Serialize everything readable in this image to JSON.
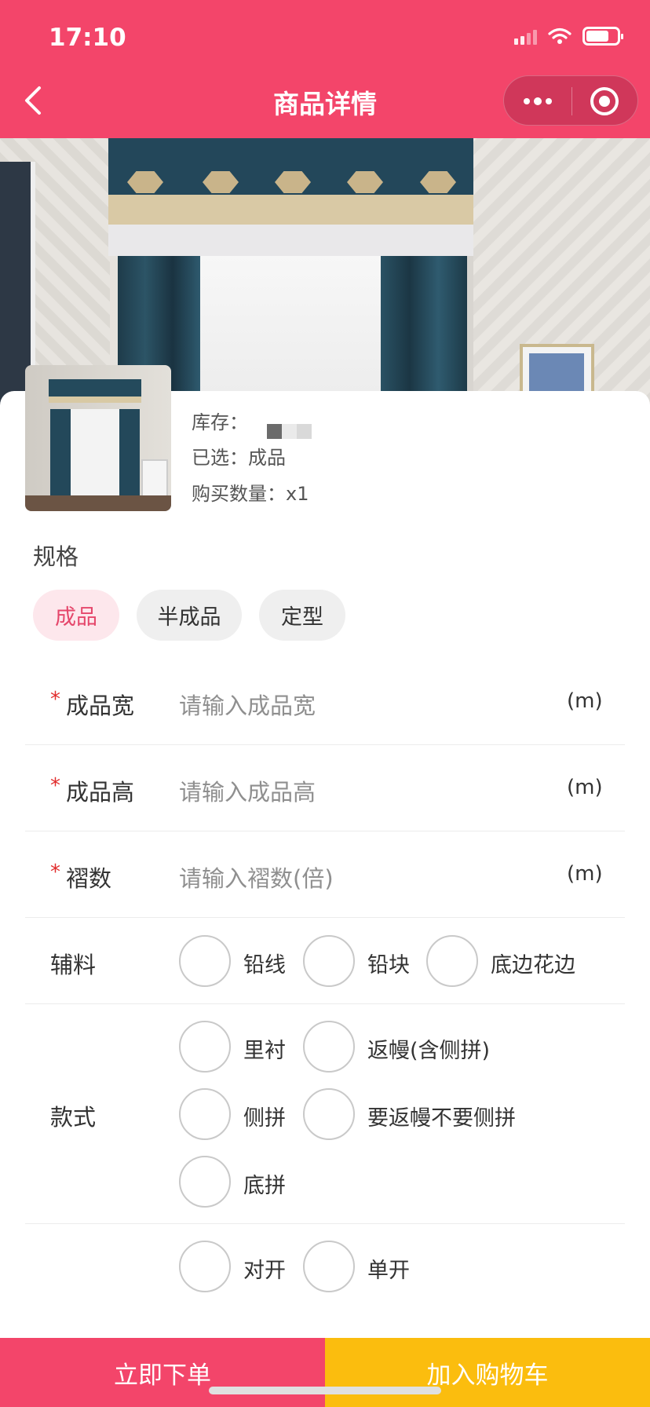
{
  "status_bar": {
    "time": "17:10"
  },
  "nav": {
    "title": "商品详情"
  },
  "product": {
    "stock_label": "库存：",
    "selected_text": "已选：成品",
    "quantity_text": "购买数量：x1"
  },
  "spec": {
    "title": "规格",
    "options": [
      "成品",
      "半成品",
      "定型"
    ],
    "selected": "成品"
  },
  "fields": {
    "width": {
      "label": "成品宽",
      "placeholder": "请输入成品宽",
      "unit": "(m)",
      "required_mark": "*"
    },
    "height": {
      "label": "成品高",
      "placeholder": "请输入成品高",
      "unit": "(m)",
      "required_mark": "*"
    },
    "pleats": {
      "label": "褶数",
      "placeholder": "请输入褶数(倍)",
      "unit": "(m)",
      "required_mark": "*"
    }
  },
  "accessories": {
    "label": "辅料",
    "options": [
      "铅线",
      "铅块",
      "底边花边"
    ]
  },
  "style": {
    "label": "款式",
    "options": [
      "里衬",
      "返幔(含侧拼)",
      "侧拼",
      "要返幔不要侧拼",
      "底拼"
    ]
  },
  "opening": {
    "options": [
      "对开",
      "单开"
    ]
  },
  "actions": {
    "buy_now": "立即下单",
    "add_to_cart": "加入购物车"
  },
  "colors": {
    "brand": "#f3456a",
    "cart": "#fbbd0e",
    "chip_active_bg": "#fde7ec",
    "chip_active_text": "#e5476b"
  }
}
